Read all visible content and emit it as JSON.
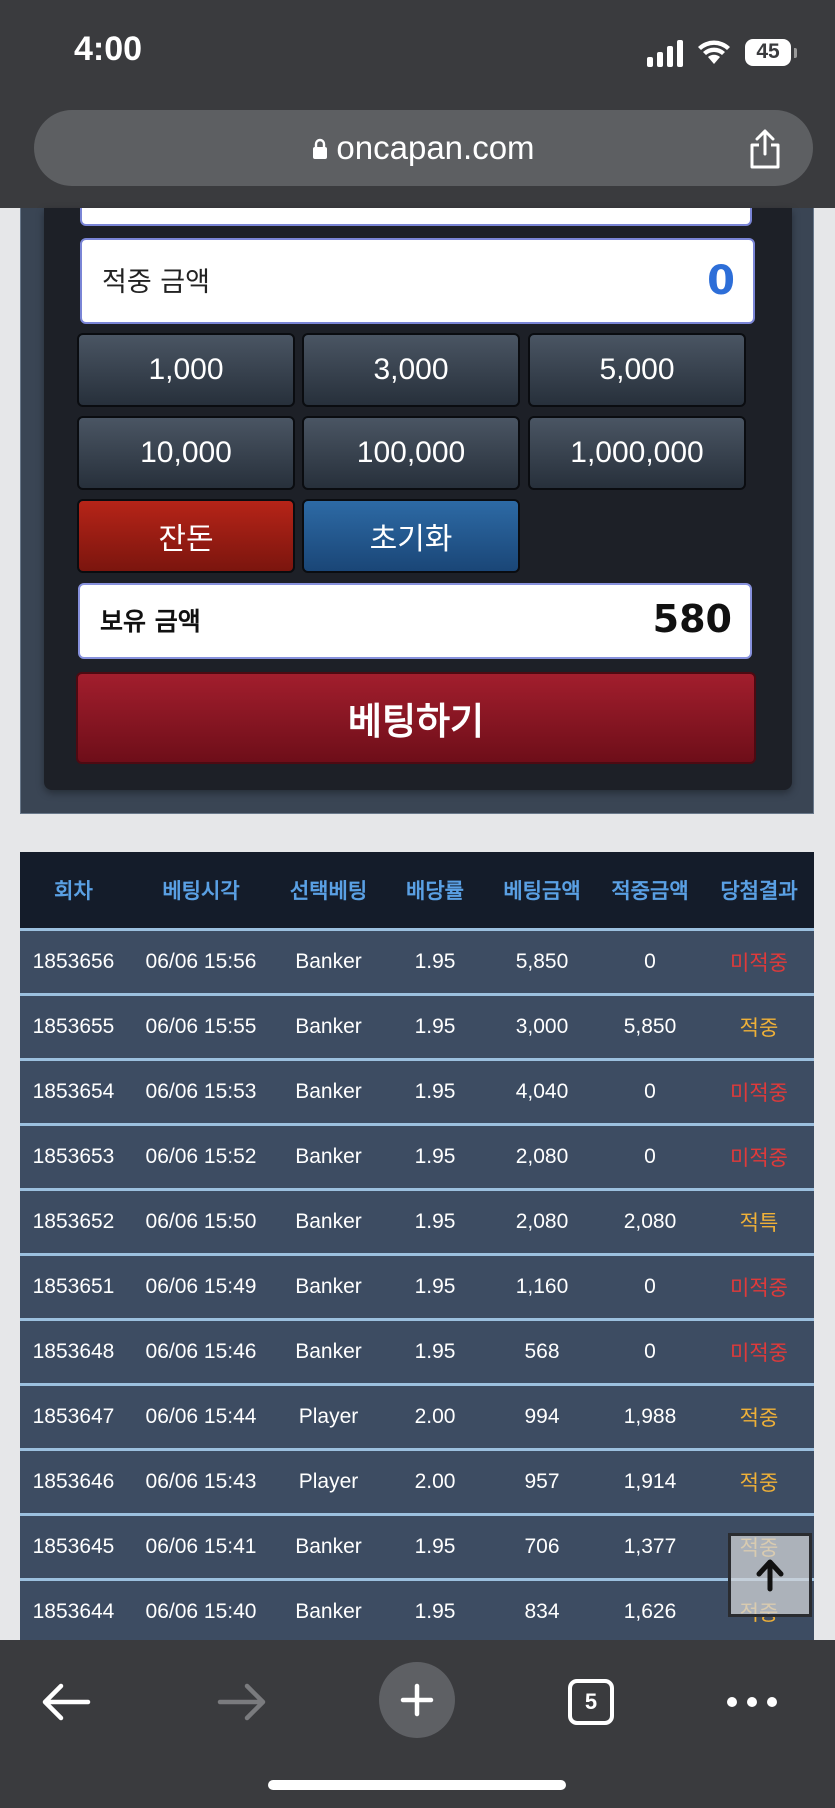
{
  "status_bar": {
    "time": "4:00",
    "battery": "45"
  },
  "browser": {
    "url": "oncapan.com",
    "tab_count": "5"
  },
  "bet_panel": {
    "hit_amount_label": "적중 금액",
    "hit_amount_value": "0",
    "amount_buttons": [
      "1,000",
      "3,000",
      "5,000",
      "10,000",
      "100,000",
      "1,000,000"
    ],
    "reset_label": "잔돈",
    "init_label": "초기화",
    "hold_amount_label": "보유 금액",
    "hold_amount_value": "580",
    "submit_label": "베팅하기"
  },
  "history": {
    "headers": [
      "회차",
      "베팅시각",
      "선택베팅",
      "배당률",
      "베팅금액",
      "적중금액",
      "당첨결과"
    ],
    "rows": [
      [
        "1853656",
        "06/06 15:56",
        "Banker",
        "1.95",
        "5,850",
        "0",
        "미적중"
      ],
      [
        "1853655",
        "06/06 15:55",
        "Banker",
        "1.95",
        "3,000",
        "5,850",
        "적중"
      ],
      [
        "1853654",
        "06/06 15:53",
        "Banker",
        "1.95",
        "4,040",
        "0",
        "미적중"
      ],
      [
        "1853653",
        "06/06 15:52",
        "Banker",
        "1.95",
        "2,080",
        "0",
        "미적중"
      ],
      [
        "1853652",
        "06/06 15:50",
        "Banker",
        "1.95",
        "2,080",
        "2,080",
        "적특"
      ],
      [
        "1853651",
        "06/06 15:49",
        "Banker",
        "1.95",
        "1,160",
        "0",
        "미적중"
      ],
      [
        "1853648",
        "06/06 15:46",
        "Banker",
        "1.95",
        "568",
        "0",
        "미적중"
      ],
      [
        "1853647",
        "06/06 15:44",
        "Player",
        "2.00",
        "994",
        "1,988",
        "적중"
      ],
      [
        "1853646",
        "06/06 15:43",
        "Player",
        "2.00",
        "957",
        "1,914",
        "적중"
      ],
      [
        "1853645",
        "06/06 15:41",
        "Banker",
        "1.95",
        "706",
        "1,377",
        "적중"
      ],
      [
        "1853644",
        "06/06 15:40",
        "Banker",
        "1.95",
        "834",
        "1,626",
        "적중"
      ]
    ]
  },
  "colors": {
    "lose": "#e03a3a",
    "win": "#f0b138",
    "header_text": "#5aa0e4"
  }
}
